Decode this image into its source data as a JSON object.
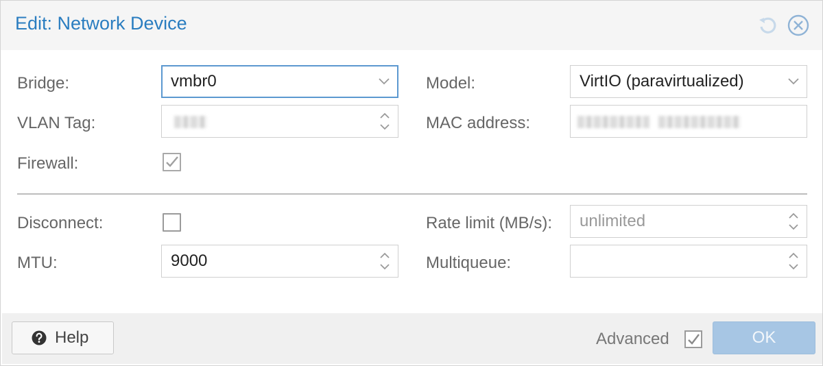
{
  "dialog": {
    "title": "Edit: Network Device",
    "icons": [
      "reset-icon",
      "close-icon"
    ]
  },
  "form": {
    "bridge": {
      "label": "Bridge:",
      "value": "vmbr0"
    },
    "vlan_tag": {
      "label": "VLAN Tag:",
      "value": ""
    },
    "firewall": {
      "label": "Firewall:",
      "checked": true
    },
    "model": {
      "label": "Model:",
      "value": "VirtIO (paravirtualized)"
    },
    "mac_address": {
      "label": "MAC address:",
      "value": ""
    },
    "disconnect": {
      "label": "Disconnect:",
      "checked": false
    },
    "mtu": {
      "label": "MTU:",
      "value": "9000"
    },
    "rate_limit": {
      "label": "Rate limit (MB/s):",
      "placeholder": "unlimited"
    },
    "multiqueue": {
      "label": "Multiqueue:",
      "value": ""
    }
  },
  "footer": {
    "help_label": "Help",
    "advanced_label": "Advanced",
    "advanced_checked": true,
    "ok_label": "OK"
  },
  "colors": {
    "title": "#2a7dc0",
    "focus_border": "#5b98d0",
    "ok_button": "#a7c6e4"
  }
}
